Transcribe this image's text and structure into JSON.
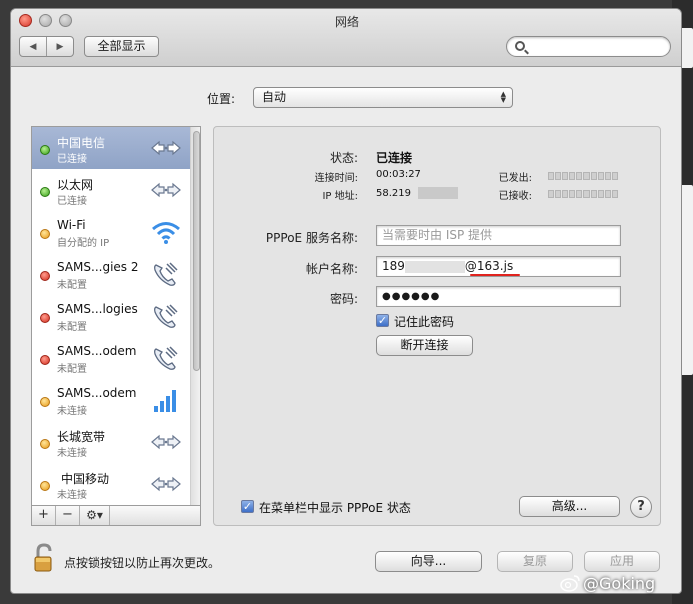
{
  "window": {
    "title": "网络"
  },
  "toolbar": {
    "show_all": "全部显示",
    "search_placeholder": ""
  },
  "location": {
    "label": "位置:",
    "value": "自动"
  },
  "services": [
    {
      "name": "中国电信",
      "status": "已连接",
      "dot": "green",
      "icon": "pppoe-arrows-icon",
      "selected": true
    },
    {
      "name": "以太网",
      "status": "已连接",
      "dot": "green",
      "icon": "ethernet-arrows-icon"
    },
    {
      "name": "Wi-Fi",
      "status": "自分配的 IP",
      "dot": "yellow",
      "icon": "wifi-icon"
    },
    {
      "name": "SAMS...gies 2",
      "status": "未配置",
      "dot": "red",
      "icon": "phone-icon"
    },
    {
      "name": "SAMS...logies",
      "status": "未配置",
      "dot": "red",
      "icon": "phone-icon"
    },
    {
      "name": "SAMS...odem",
      "status": "未配置",
      "dot": "red",
      "icon": "phone-icon"
    },
    {
      "name": "SAMS...odem",
      "status": "未连接",
      "dot": "yellow",
      "icon": "signal-bars-icon"
    },
    {
      "name": "长城宽带",
      "status": "未连接",
      "dot": "yellow",
      "icon": "pppoe-arrows-icon"
    },
    {
      "name": "中国移动",
      "status": "未连接",
      "dot": "yellow",
      "icon": "pppoe-arrows-icon"
    }
  ],
  "sidebar_tools": {
    "add": "+",
    "remove": "−",
    "gear": "⚙▾"
  },
  "detail": {
    "status_label": "状态:",
    "status_value": "已连接",
    "connect_time_label": "连接时间:",
    "connect_time_value": "00:03:27",
    "ip_label": "IP 地址:",
    "ip_value": "58.219",
    "sent_label": "已发出:",
    "received_label": "已接收:",
    "service_name_label": "PPPoE 服务名称:",
    "service_name_placeholder": "当需要时由 ISP 提供",
    "account_label": "帐户名称:",
    "account_prefix": "189",
    "account_suffix": "@163.js",
    "password_label": "密码:",
    "password_value": "●●●●●●",
    "remember_password": "记住此密码",
    "disconnect": "断开连接",
    "show_in_menubar": "在菜单栏中显示 PPPoE 状态",
    "advanced": "高级...",
    "help": "?"
  },
  "footer": {
    "lock_text": "点按锁按钮以防止再次更改。",
    "assistant": "向导...",
    "revert": "复原",
    "apply": "应用"
  },
  "watermark": "@Goking",
  "colors": {
    "selected_row": "#97a9ca",
    "connected": "#3aa01c",
    "not_connected": "#e89b1a",
    "not_configured": "#d33020",
    "annotation_underline": "#e0231e"
  }
}
